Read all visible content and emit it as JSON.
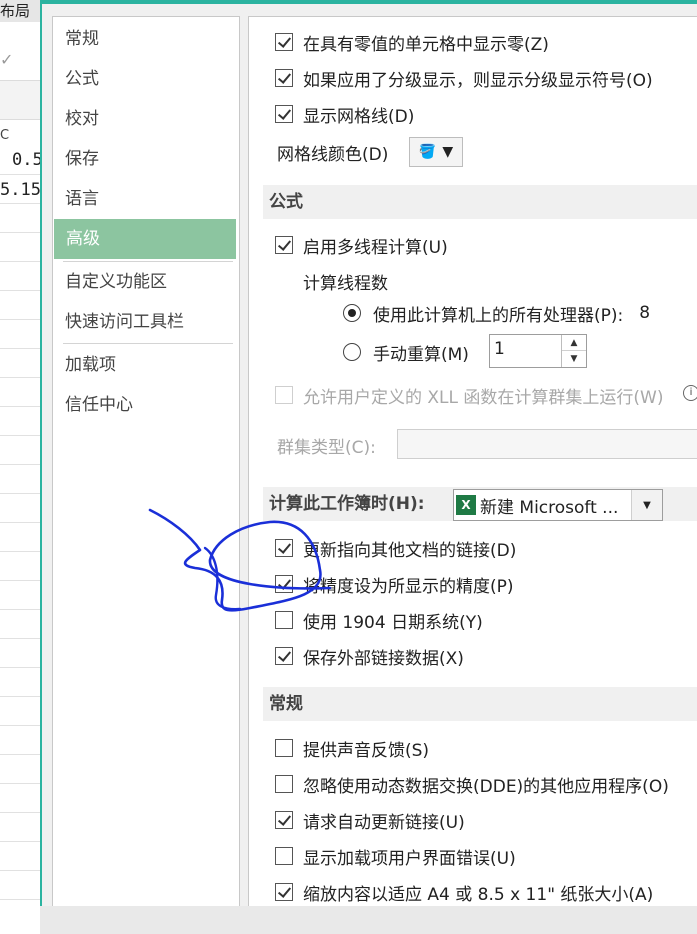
{
  "background": {
    "title_fragment": "布局",
    "col_header": "C",
    "cells": [
      "0.5",
      "5.15"
    ]
  },
  "nav": {
    "items": [
      {
        "label": "常规",
        "active": false
      },
      {
        "label": "公式",
        "active": false
      },
      {
        "label": "校对",
        "active": false
      },
      {
        "label": "保存",
        "active": false
      },
      {
        "label": "语言",
        "active": false
      },
      {
        "label": "高级",
        "active": true
      },
      {
        "label": "自定义功能区",
        "active": false
      },
      {
        "label": "快速访问工具栏",
        "active": false
      },
      {
        "label": "加载项",
        "active": false
      },
      {
        "label": "信任中心",
        "active": false
      }
    ]
  },
  "display": {
    "show_zero": {
      "label": "在具有零值的单元格中显示零(Z)",
      "checked": true
    },
    "outline_symbols": {
      "label": "如果应用了分级显示，则显示分级显示符号(O)",
      "checked": true
    },
    "gridlines": {
      "label": "显示网格线(D)",
      "checked": true
    },
    "gridline_color_label": "网格线颜色(D)"
  },
  "formulas": {
    "section_title": "公式",
    "multithread": {
      "label": "启用多线程计算(U)",
      "checked": true
    },
    "threads_label": "计算线程数",
    "use_all": {
      "label": "使用此计算机上的所有处理器(P):",
      "value": "8",
      "selected": true
    },
    "manual": {
      "label": "手动重算(M)",
      "value": "1",
      "selected": false
    },
    "xll": {
      "label": "允许用户定义的 XLL 函数在计算群集上运行(W)",
      "checked": false
    },
    "cluster_type_label": "群集类型(C):"
  },
  "workbook": {
    "section_title": "计算此工作簿时(H):",
    "selected": "新建 Microsoft ...",
    "icon": "excel-icon",
    "update_links": {
      "label": "更新指向其他文档的链接(D)",
      "checked": true
    },
    "precision": {
      "label": "将精度设为所显示的精度(P)",
      "checked": true
    },
    "date1904": {
      "label": "使用 1904 日期系统(Y)",
      "checked": false
    },
    "save_external": {
      "label": "保存外部链接数据(X)",
      "checked": true
    }
  },
  "general": {
    "section_title": "常规",
    "sound": {
      "label": "提供声音反馈(S)",
      "checked": false
    },
    "dde": {
      "label": "忽略使用动态数据交换(DDE)的其他应用程序(O)",
      "checked": false
    },
    "auto_update": {
      "label": "请求自动更新链接(U)",
      "checked": true
    },
    "addin_errors": {
      "label": "显示加载项用户界面错误(U)",
      "checked": false
    },
    "scale_a4": {
      "label": "缩放内容以适应 A4 或 8.5 x 11\" 纸张大小(A)",
      "checked": true
    }
  },
  "colors": {
    "accent": "#2bb3a0",
    "nav_active": "#8cc5a0",
    "annotation": "#1a2fd8"
  }
}
